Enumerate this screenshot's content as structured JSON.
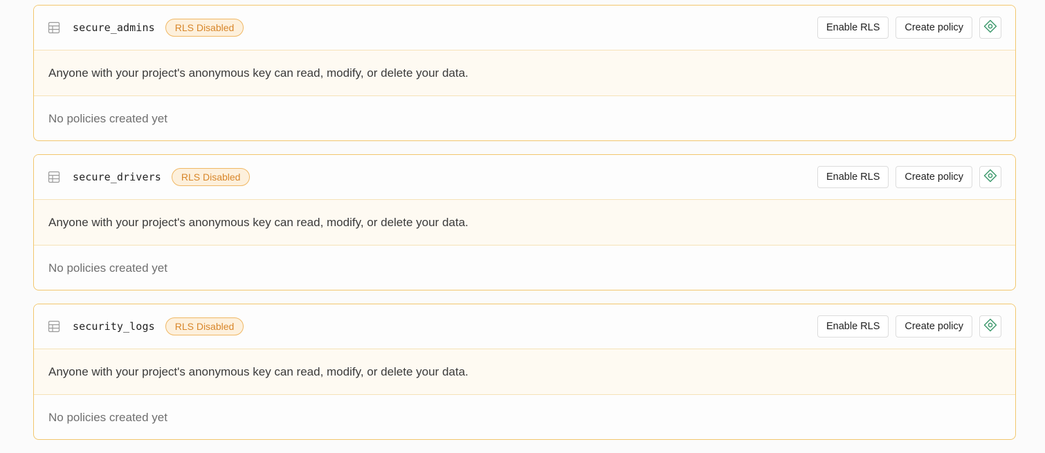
{
  "tables": [
    {
      "name": "secure_admins",
      "status_badge": "RLS Disabled",
      "enable_rls_label": "Enable RLS",
      "create_policy_label": "Create policy",
      "warning": "Anyone with your project's anonymous key can read, modify, or delete your data.",
      "policies_empty_text": "No policies created yet"
    },
    {
      "name": "secure_drivers",
      "status_badge": "RLS Disabled",
      "enable_rls_label": "Enable RLS",
      "create_policy_label": "Create policy",
      "warning": "Anyone with your project's anonymous key can read, modify, or delete your data.",
      "policies_empty_text": "No policies created yet"
    },
    {
      "name": "security_logs",
      "status_badge": "RLS Disabled",
      "enable_rls_label": "Enable RLS",
      "create_policy_label": "Create policy",
      "warning": "Anyone with your project's anonymous key can read, modify, or delete your data.",
      "policies_empty_text": "No policies created yet"
    }
  ],
  "icons": {
    "table": "table-grid-icon",
    "assistant": "ai-assistant-diamond-icon"
  },
  "colors": {
    "card_border": "#f2c76e",
    "warning_bg": "#fefaf2",
    "badge_text": "#d8862a",
    "badge_bg": "#fdf0dc",
    "assistant_icon": "#3f9a6e"
  }
}
